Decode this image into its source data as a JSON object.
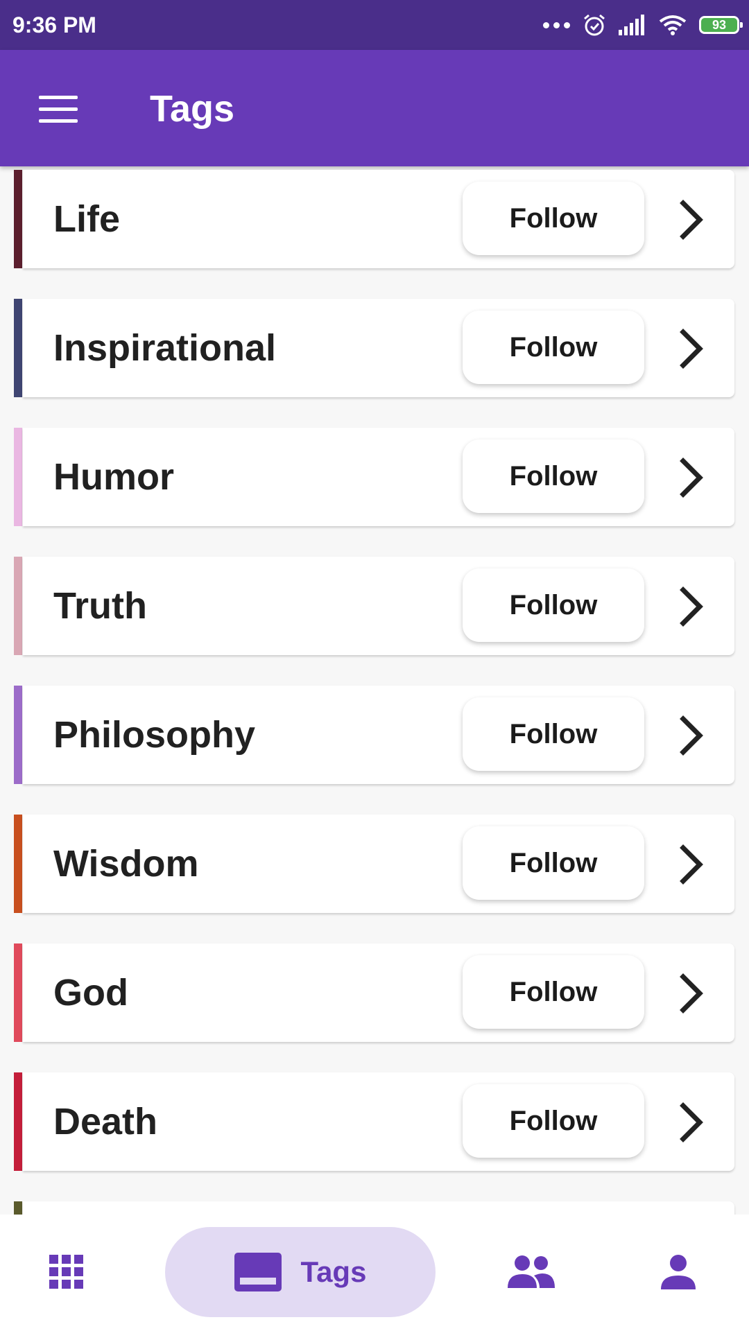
{
  "status_bar": {
    "time": "9:36 PM",
    "battery": "93",
    "icons": [
      "more-dots-icon",
      "alarm-icon",
      "signal-icon",
      "wifi-icon",
      "battery-icon"
    ]
  },
  "app_bar": {
    "title": "Tags",
    "menu_icon": "hamburger-menu-icon"
  },
  "tags": [
    {
      "name": "Life",
      "follow_label": "Follow",
      "color": "#5c1f2e"
    },
    {
      "name": "Inspirational",
      "follow_label": "Follow",
      "color": "#3f4572"
    },
    {
      "name": "Humor",
      "follow_label": "Follow",
      "color": "#eab7e2"
    },
    {
      "name": "Truth",
      "follow_label": "Follow",
      "color": "#d9a7b4"
    },
    {
      "name": "Philosophy",
      "follow_label": "Follow",
      "color": "#9c6cc9"
    },
    {
      "name": "Wisdom",
      "follow_label": "Follow",
      "color": "#c84f1f"
    },
    {
      "name": "God",
      "follow_label": "Follow",
      "color": "#e04a5c"
    },
    {
      "name": "Death",
      "follow_label": "Follow",
      "color": "#c41e3a"
    },
    {
      "name": "",
      "follow_label": "",
      "color": "#5a5a2c"
    }
  ],
  "bottom_nav": {
    "items": [
      {
        "icon": "grid-icon",
        "label": ""
      },
      {
        "icon": "tags-icon",
        "label": "Tags",
        "active": true
      },
      {
        "icon": "people-icon",
        "label": ""
      },
      {
        "icon": "person-icon",
        "label": ""
      }
    ]
  },
  "colors": {
    "status_bar": "#4a2e8a",
    "app_bar": "#673ab7",
    "accent": "#673ab7",
    "active_pill": "#e2daf3"
  }
}
